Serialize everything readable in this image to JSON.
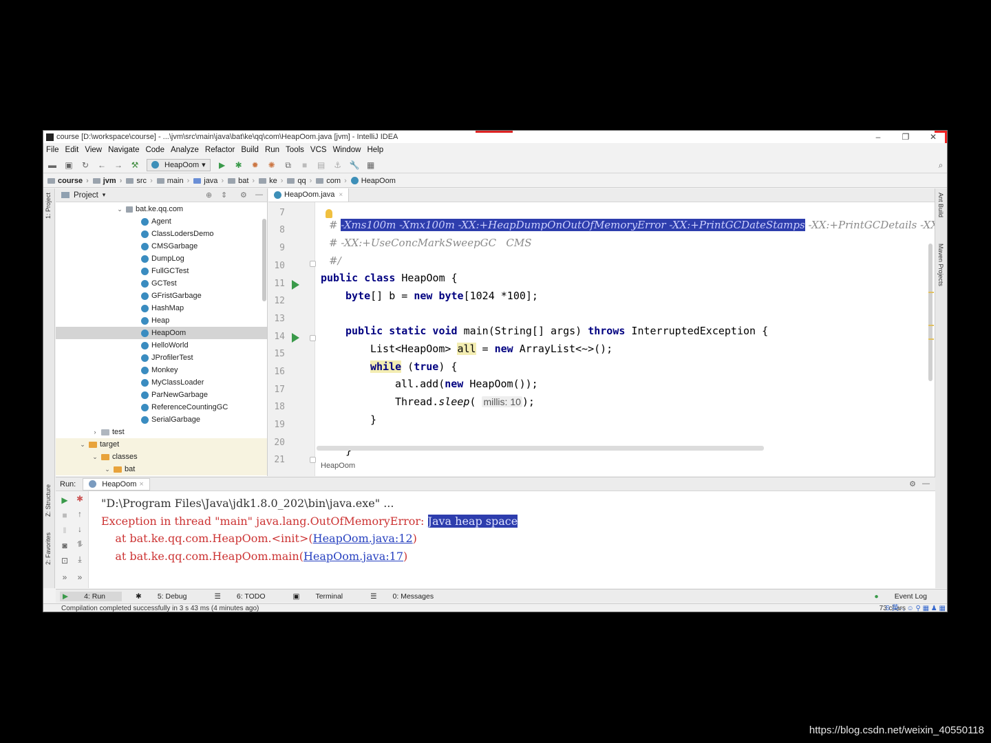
{
  "window": {
    "title": "course [D:\\workspace\\course] - ...\\jvm\\src\\main\\java\\bat\\ke\\qq\\com\\HeapOom.java [jvm] - IntelliJ IDEA",
    "minimize": "–",
    "restore": "❐",
    "close": "✕"
  },
  "menu": [
    "File",
    "Edit",
    "View",
    "Navigate",
    "Code",
    "Analyze",
    "Refactor",
    "Build",
    "Run",
    "Tools",
    "VCS",
    "Window",
    "Help"
  ],
  "toolbar": {
    "run_config": "HeapOom",
    "run_config_arrow": "▾",
    "search_icon": "⌕"
  },
  "breadcrumbs": [
    "course",
    "jvm",
    "src",
    "main",
    "java",
    "bat",
    "ke",
    "qq",
    "com",
    "HeapOom"
  ],
  "side_tabs": {
    "project": "1: Project",
    "structure": "Z: Structure",
    "favorites": "2: Favorites",
    "ant": "Ant Build",
    "maven": "Maven Projects"
  },
  "project": {
    "header": "Project",
    "header_arrow": "▾",
    "package": "bat.ke.qq.com",
    "classes": [
      "Agent",
      "ClassLodersDemo",
      "CMSGarbage",
      "DumpLog",
      "FullGCTest",
      "GCTest",
      "GFristGarbage",
      "HashMap",
      "Heap",
      "HeapOom",
      "HelloWorld",
      "JProfilerTest",
      "Monkey",
      "MyClassLoader",
      "ParNewGarbage",
      "ReferenceCountingGC",
      "SerialGarbage"
    ],
    "selected": "HeapOom",
    "folders": [
      {
        "arrow": "›",
        "name": "test"
      },
      {
        "arrow": "⌄",
        "name": "target"
      },
      {
        "arrow": "⌄",
        "name": "classes"
      },
      {
        "arrow": "⌄",
        "name": "bat"
      }
    ]
  },
  "editor": {
    "tab": "HeapOom.java",
    "tab_close": "×",
    "line_numbers": [
      "7",
      "8",
      "9",
      "10",
      "11",
      "12",
      "13",
      "14",
      "15",
      "16",
      "17",
      "18",
      "19",
      "20",
      "21"
    ],
    "line8_prefix": "# ",
    "line8_selected": "-Xms100m -Xmx100m -XX:+HeapDumpOnOutOfMemoryError -XX:+PrintGCDateStamps",
    "line8_rest": " -XX:+PrintGCDetails -XX:",
    "line9": "# -XX:+UseConcMarkSweepGC   CMS",
    "line10": "#/",
    "line11_kw": "public class",
    "line11_rest": " HeapOom {",
    "line12_kw1": "byte",
    "line12_mid": "[] b = ",
    "line12_kw2": "new byte",
    "line12_rest": "[1024 *100];",
    "line14_kw": "public static void",
    "line14_mid": " main(String[] args) ",
    "line14_kw2": "throws",
    "line14_rest": " InterruptedException {",
    "line15_a": "List<HeapOom> ",
    "line15_var": "all",
    "line15_b": " = ",
    "line15_kw": "new",
    "line15_c": " ArrayList<~>();",
    "line16_kw": "while",
    "line16_a": " (",
    "line16_kw2": "true",
    "line16_b": ") {",
    "line17_a": "all.add(",
    "line17_kw": "new",
    "line17_b": " HeapOom());",
    "line18_a": "Thread.",
    "line18_method": "sleep",
    "line18_b": "( ",
    "line18_hint": "millis: 10",
    "line18_c": ");",
    "line19": "}",
    "line21": "}",
    "breadcrumb": "HeapOom",
    "cursor": "I"
  },
  "run": {
    "label": "Run:",
    "tab": "HeapOom",
    "tab_close": "×",
    "line1": "\"D:\\Program Files\\Java\\jdk1.8.0_202\\bin\\java.exe\" ...",
    "line2_prefix": "Exception in thread \"main\" java.lang.OutOfMemoryError: ",
    "line2_selected": "Java heap space",
    "line3_prefix": "    at bat.ke.qq.com.HeapOom.<init>(",
    "line3_link": "HeapOom.java:12",
    "line3_suffix": ")",
    "line4_prefix": "    at bat.ke.qq.com.HeapOom.main(",
    "line4_link": "HeapOom.java:17",
    "line4_suffix": ")"
  },
  "bottom_tabs": [
    "4: Run",
    "5: Debug",
    "6: TODO",
    "Terminal",
    "0: Messages"
  ],
  "event_log": "Event Log",
  "status": {
    "message": "Compilation completed successfully in 3 s 43 ms (4 minutes ago)",
    "right": "73 chars",
    "tray": "S 英 ·, ☺ ⚲ ▦ ♟ ▦"
  },
  "watermark": "https://blog.csdn.net/weixin_40550118",
  "colors": {
    "selection": "#2d3dad",
    "keyword": "#000080",
    "error_text": "#cc3333",
    "link": "#2741c0",
    "run_green": "#3a9a4a"
  }
}
